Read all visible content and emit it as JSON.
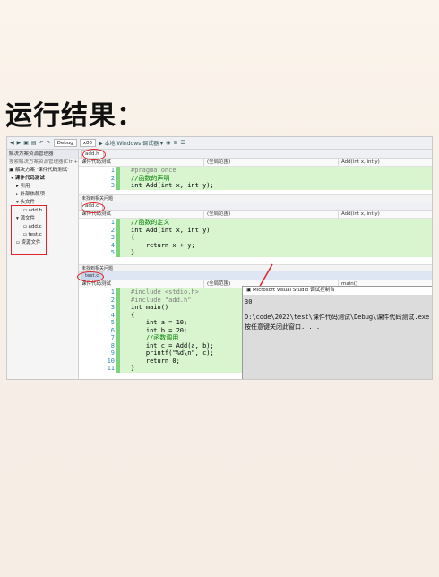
{
  "heading": "运行结果：",
  "toolbar": {
    "config": "Debug",
    "platform": "x86",
    "run_label": "▶ 本地 Windows 调试器 ▾"
  },
  "sidebar": {
    "title": "解决方案资源管理器",
    "search": "搜索解决方案资源管理器(Ctrl+;)",
    "solution": "解决方案 '课件代码测试'",
    "project": "课件代码测试",
    "items": [
      "引用",
      "外部依赖项",
      "头文件",
      "add.h",
      "源文件",
      "add.c",
      "test.c",
      "资源文件"
    ]
  },
  "panes": [
    {
      "tab": "add.h",
      "project": "课件代码测试",
      "scope": "(全局范围)",
      "func": "Add(int x, int y)",
      "lines": [
        {
          "n": "1",
          "t": "#pragma once"
        },
        {
          "n": "2",
          "t": "//函数的声明"
        },
        {
          "n": "3",
          "t": "int Add(int x, int y);"
        }
      ],
      "status": "未找到相关问题"
    },
    {
      "tab": "add.c",
      "project": "课件代码测试",
      "scope": "(全局范围)",
      "func": "Add(int x, int y)",
      "lines": [
        {
          "n": "1",
          "t": "//函数的定义"
        },
        {
          "n": "2",
          "t": "int Add(int x, int y)"
        },
        {
          "n": "3",
          "t": "{"
        },
        {
          "n": "4",
          "t": "    return x + y;"
        },
        {
          "n": "5",
          "t": "}"
        }
      ],
      "status": "未找到相关问题"
    },
    {
      "tab": "test.c",
      "project": "课件代码测试",
      "scope": "(全局范围)",
      "func": "main()",
      "lines": [
        {
          "n": "1",
          "t": "#include <stdio.h>"
        },
        {
          "n": "2",
          "t": "#include \"add.h\""
        },
        {
          "n": "3",
          "t": "int main()"
        },
        {
          "n": "4",
          "t": "{"
        },
        {
          "n": "5",
          "t": "    int a = 10;"
        },
        {
          "n": "6",
          "t": "    int b = 20;"
        },
        {
          "n": "7",
          "t": "    //函数调用"
        },
        {
          "n": "8",
          "t": "    int c = Add(a, b);"
        },
        {
          "n": "9",
          "t": "    printf(\"%d\\n\", c);"
        },
        {
          "n": "10",
          "t": "    return 0;"
        },
        {
          "n": "11",
          "t": "}"
        }
      ]
    }
  ],
  "console": {
    "title": "Microsoft Visual Studio 调试控制台",
    "output": "30",
    "path": "D:\\code\\2022\\test\\课件代码测试\\Debug\\课件代码测试.exe",
    "prompt": "按任意键关闭此窗口. . ."
  },
  "colors": {
    "annotation_red": "#e0242a",
    "highlight_green": "#7fd37f"
  }
}
